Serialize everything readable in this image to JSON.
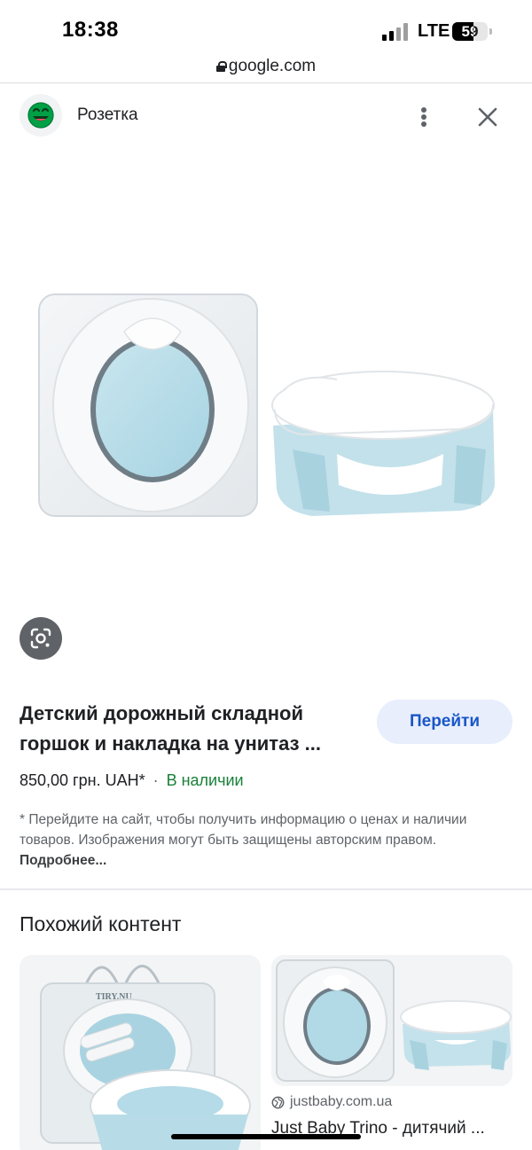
{
  "status_bar": {
    "time": "18:38",
    "network": "LTE",
    "battery": "59",
    "battery_level_percent": 59
  },
  "browser": {
    "url": "google.com"
  },
  "site": {
    "name": "Розетка",
    "logo_icon": "rozetka-smiley-icon",
    "logo_color": "#00a046"
  },
  "product": {
    "title": "Детский дорожный складной горшок и накладка на унитаз ...",
    "go_button_label": "Перейти",
    "price": "850,00 грн. UAH*",
    "separator": "·",
    "availability": "В наличии",
    "disclaimer": "* Перейдите на сайт, чтобы получить информацию о ценах и наличии товаров. Изображения могут быть защищены авторским правом.",
    "more_link": "Подробнее..."
  },
  "similar": {
    "heading": "Похожий контент",
    "cards": [
      {
        "image_text": "TIRY.NU",
        "source": "",
        "caption": ""
      },
      {
        "source": "justbaby.com.ua",
        "caption": "Just Baby Trino - дитячий ..."
      }
    ]
  },
  "colors": {
    "accent_blue": "#1a56c8",
    "button_bg": "#e8eefc",
    "in_stock_green": "#188038",
    "potty_blue": "#b9dde8"
  }
}
